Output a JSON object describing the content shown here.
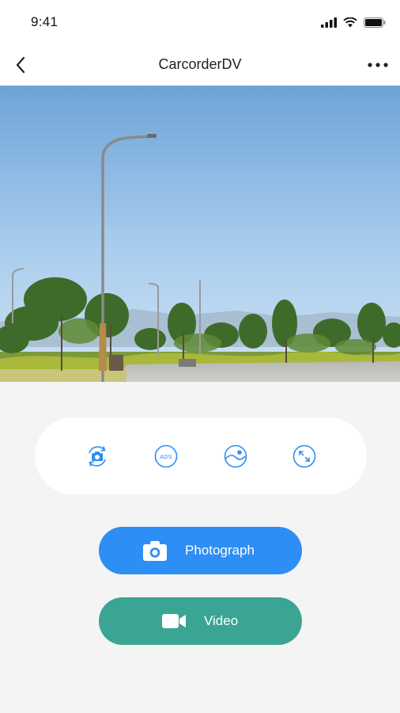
{
  "status_bar": {
    "time": "9:41"
  },
  "nav": {
    "title": "CarcorderDV"
  },
  "preview": {
    "description_icon": "camera-live-preview"
  },
  "tools": [
    {
      "name": "switch-camera-icon"
    },
    {
      "name": "adas-icon",
      "label": "ADS"
    },
    {
      "name": "image-gallery-icon"
    },
    {
      "name": "fullscreen-icon"
    }
  ],
  "actions": {
    "photograph_label": "Photograph",
    "video_label": "Video"
  },
  "colors": {
    "accent_blue": "#2d8ef5",
    "accent_green": "#3aa592",
    "icon_blue": "#2d8ef5"
  }
}
